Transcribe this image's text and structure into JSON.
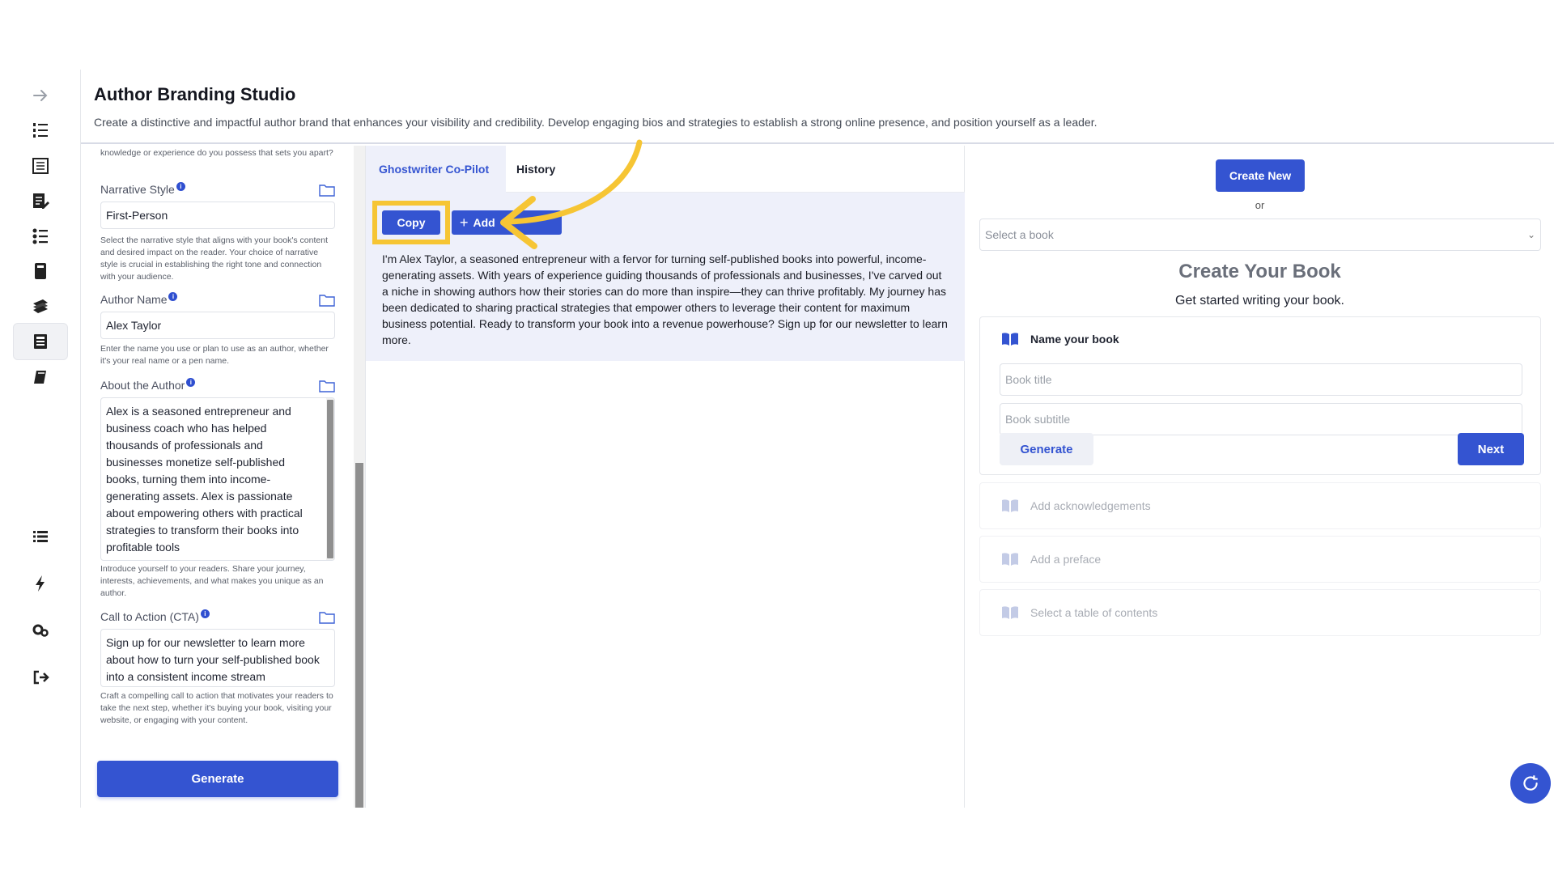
{
  "header": {
    "title": "Author Branding Studio",
    "subtitle": "Create a distinctive and impactful author brand that enhances your visibility and credibility. Develop engaging bios and strategies to establish a strong online presence, and position yourself as a leader."
  },
  "sidebar": {
    "items": [
      {
        "icon": "arrow-right-icon"
      },
      {
        "icon": "ordered-list-icon"
      },
      {
        "icon": "document-table-icon"
      },
      {
        "icon": "edit-document-icon"
      },
      {
        "icon": "checklist-icon"
      },
      {
        "icon": "book-stack-icon"
      },
      {
        "icon": "books-icon"
      },
      {
        "icon": "branding-studio-icon",
        "active": true
      },
      {
        "icon": "notebook-icon"
      },
      {
        "icon": "list-icon"
      },
      {
        "icon": "bolt-icon"
      },
      {
        "icon": "settings-icon"
      },
      {
        "icon": "logout-icon"
      }
    ]
  },
  "form": {
    "top_hint": "knowledge or experience do you possess that sets you apart?",
    "narrative_style": {
      "label": "Narrative Style",
      "value": "First-Person",
      "hint": "Select the narrative style that aligns with your book's content and desired impact on the reader. Your choice of narrative style is crucial in establishing the right tone and connection with your audience."
    },
    "author_name": {
      "label": "Author Name",
      "value": "Alex Taylor",
      "hint": "Enter the name you use or plan to use as an author, whether it's your real name or a pen name."
    },
    "about_author": {
      "label": "About the Author",
      "value": "Alex is a seasoned entrepreneur and business coach who has helped thousands of professionals and businesses monetize self-published books, turning them into income-generating assets. Alex is passionate about empowering others with practical strategies to transform their books into profitable tools",
      "hint": "Introduce yourself to your readers. Share your journey, interests, achievements, and what makes you unique as an author."
    },
    "cta": {
      "label": "Call to Action (CTA)",
      "value": "Sign up for our newsletter to learn more about how to turn your self-published book into a consistent income stream",
      "hint": "Craft a compelling call to action that motivates your readers to take the next step, whether it's buying your book, visiting your website, or engaging with your content."
    },
    "info_glyph": "i",
    "generate_label": "Generate"
  },
  "middle": {
    "tabs": [
      {
        "label": "Ghostwriter Co-Pilot",
        "active": true
      },
      {
        "label": "History",
        "active": false
      }
    ],
    "copy_label": "Copy",
    "add_label": "Add",
    "result_text": "I'm Alex Taylor, a seasoned entrepreneur with a fervor for turning self-published books into powerful, income-generating assets. With years of experience guiding thousands of professionals and businesses, I've carved out a niche in showing authors how their stories can do more than inspire—they can thrive profitably. My journey has been dedicated to sharing practical strategies that empower others to leverage their content for maximum business potential. Ready to transform your book into a revenue powerhouse? Sign up for our newsletter to learn more."
  },
  "right": {
    "create_new_label": "Create New",
    "or_label": "or",
    "select_placeholder": "Select a book",
    "create_title": "Create Your Book",
    "create_subtitle": "Get started writing your book.",
    "name_step_label": "Name your book",
    "book_title_placeholder": "Book title",
    "book_subtitle_placeholder": "Book subtitle",
    "generate_label": "Generate",
    "next_label": "Next",
    "steps": [
      {
        "label": "Add acknowledgements"
      },
      {
        "label": "Add a preface"
      },
      {
        "label": "Select a table of contents"
      }
    ]
  },
  "colors": {
    "accent": "#3454d1",
    "highlight": "#f6c534",
    "panel_bg": "#eef0fa"
  }
}
